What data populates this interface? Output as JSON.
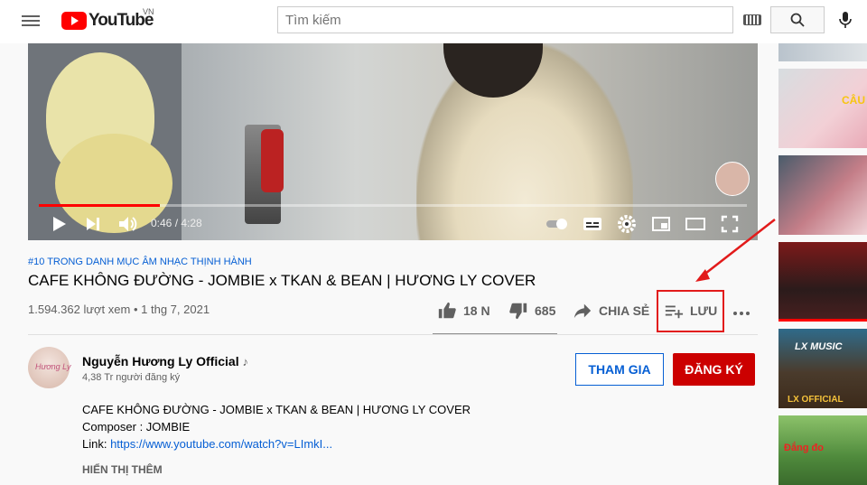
{
  "header": {
    "logo_text": "YouTube",
    "country_code": "VN",
    "search_placeholder": "Tìm kiếm"
  },
  "player": {
    "current_time": "0:46",
    "duration": "4:28",
    "progress": 0.171
  },
  "video": {
    "hashtag": "#10 TRONG DANH MỤC ÂM NHẠC THỊNH HÀNH",
    "title": "CAFE KHÔNG ĐƯỜNG - JOMBIE x TKAN & BEAN | HƯƠNG LY COVER",
    "views": "1.594.362 lượt xem",
    "separator": "•",
    "date": "1 thg 7, 2021"
  },
  "actions": {
    "likes": "18 N",
    "dislikes": "685",
    "share": "CHIA SẺ",
    "save": "LƯU"
  },
  "channel": {
    "avatar_text": "Hương Ly",
    "name": "Nguyễn Hương Ly Official",
    "subscribers": "4,38 Tr người đăng ký",
    "join_label": "THAM GIA",
    "subscribe_label": "ĐĂNG KÝ"
  },
  "description": {
    "line1": "CAFE KHÔNG ĐƯỜNG - JOMBIE x TKAN & BEAN | HƯƠNG LY COVER",
    "line2": "Composer : JOMBIE",
    "link_prefix": "Link: ",
    "link": "https://www.youtube.com/watch?v=LImkI...",
    "show_more": "HIỂN THỊ THÊM"
  },
  "sidebar_thumbnails": {
    "thumb2_text": "CÂU",
    "thumb4_text": "LX MUSIC",
    "thumb5_text": "LX OFFICIAL",
    "thumb6_text": "Đắng đo"
  },
  "colors": {
    "accent_red": "#ff0000",
    "subscribe_red": "#cc0000",
    "link_blue": "#065fd4",
    "annotation_red": "#e21b1b"
  }
}
